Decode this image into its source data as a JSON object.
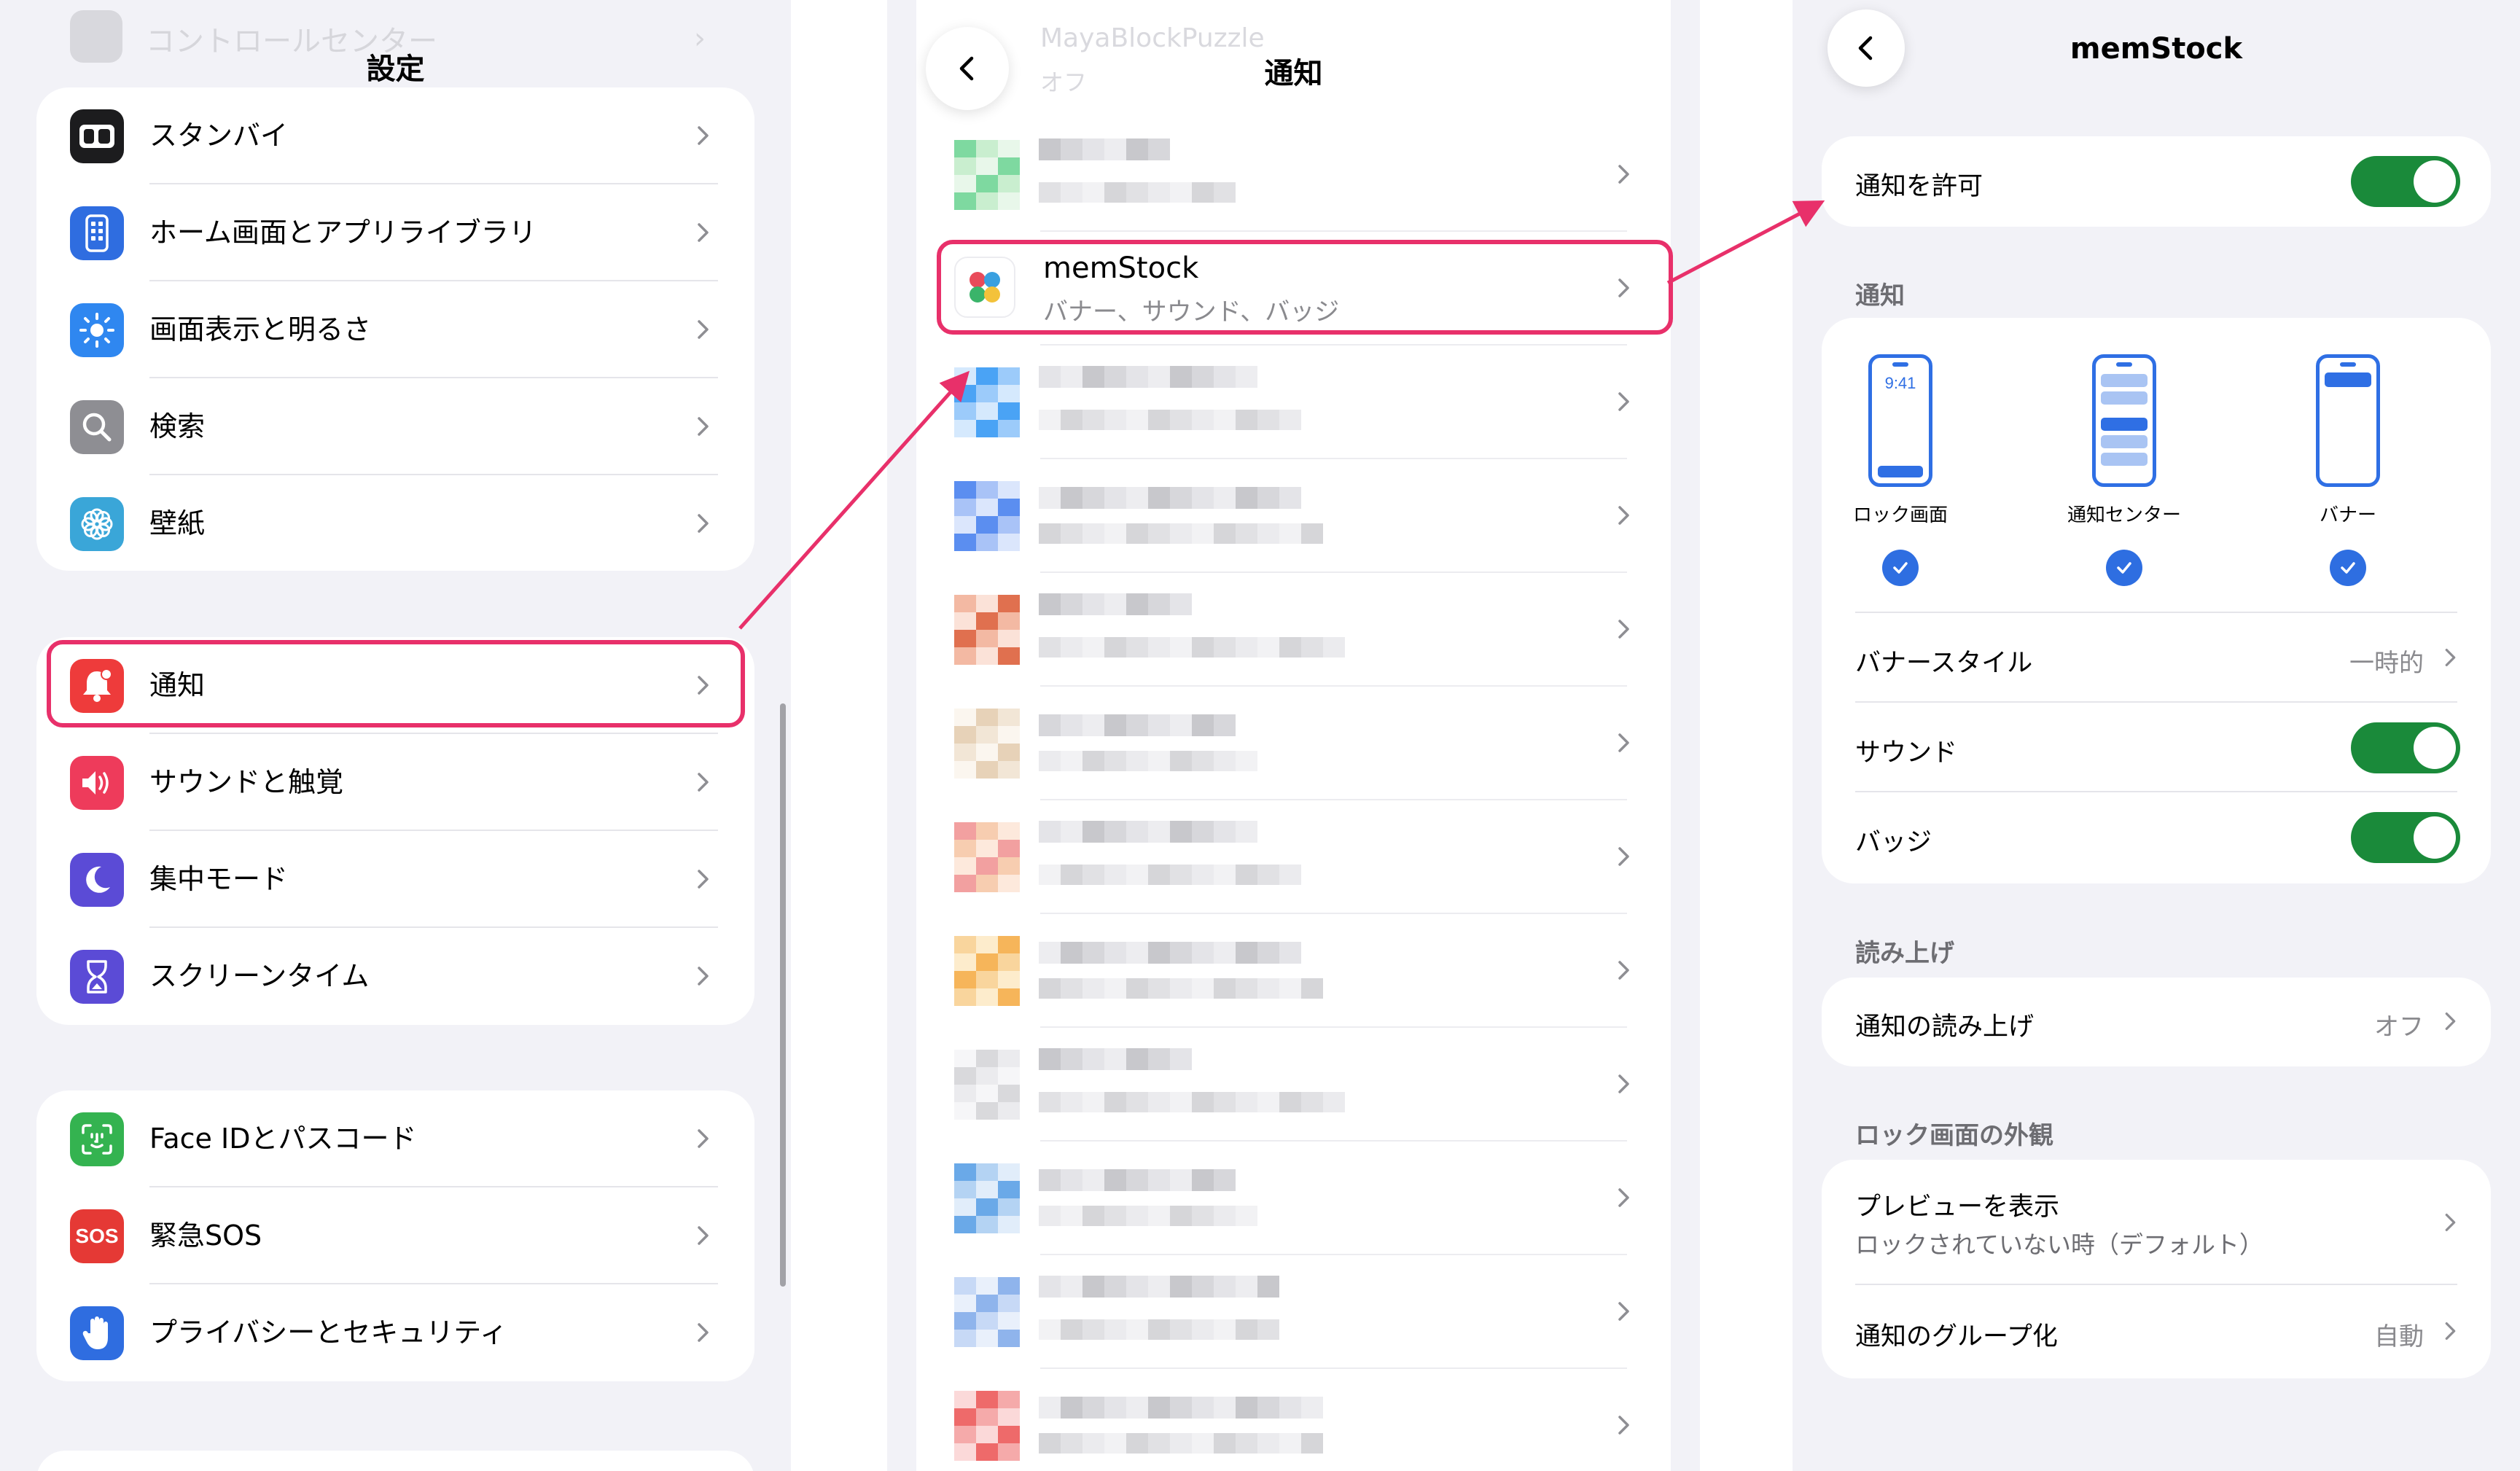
{
  "settings": {
    "ghost_item": "コントロールセンター",
    "title": "設定",
    "group1": [
      {
        "label": "スタンバイ",
        "icon": "standby-icon",
        "color": "#1c1c1e"
      },
      {
        "label": "ホーム画面とアプリライブラリ",
        "icon": "home-screen-icon",
        "color": "#2f6de0"
      },
      {
        "label": "画面表示と明るさ",
        "icon": "brightness-icon",
        "color": "#2f87f0"
      },
      {
        "label": "検索",
        "icon": "search-icon",
        "color": "#8e8e93"
      },
      {
        "label": "壁紙",
        "icon": "wallpaper-icon",
        "color": "#3aa6d8"
      }
    ],
    "group2": [
      {
        "label": "通知",
        "icon": "notification-bell-icon",
        "color": "#ee3b3b"
      },
      {
        "label": "サウンドと触覚",
        "icon": "speaker-icon",
        "color": "#ee3b5b"
      },
      {
        "label": "集中モード",
        "icon": "moon-icon",
        "color": "#5b4bd6"
      },
      {
        "label": "スクリーンタイム",
        "icon": "hourglass-icon",
        "color": "#5b4bd6"
      }
    ],
    "group3": [
      {
        "label": "Face IDとパスコード",
        "icon": "face-id-icon",
        "color": "#34b350"
      },
      {
        "label": "緊急SOS",
        "icon": "sos-icon",
        "color": "#e53935",
        "badge": "SOS"
      },
      {
        "label": "プライバシーとセキュリティ",
        "icon": "hand-icon",
        "color": "#2f6de0"
      }
    ]
  },
  "notifications": {
    "title": "通知",
    "ghost_app": "MayaBlockPuzzle",
    "ghost_sub": "オフ",
    "highlighted_app": {
      "name": "memStock",
      "summary": "バナー、サウンド、バッジ"
    }
  },
  "app_settings": {
    "title": "memStock",
    "allow_label": "通知を許可",
    "section_alerts": "通知",
    "styles": [
      "ロック画面",
      "通知センター",
      "バナー"
    ],
    "lock_time": "9:41",
    "banner_style_label": "バナースタイル",
    "banner_style_value": "一時的",
    "sound_label": "サウンド",
    "badge_label": "バッジ",
    "section_announce": "読み上げ",
    "announce_label": "通知の読み上げ",
    "announce_value": "オフ",
    "section_lock": "ロック画面の外観",
    "preview_label": "プレビューを表示",
    "preview_value": "ロックされていない時（デフォルト）",
    "grouping_label": "通知のグループ化",
    "grouping_value": "自動"
  },
  "colors": {
    "highlight": "#e8306a",
    "toggle_on": "#1a8a3a",
    "accent_blue": "#2f6fe4"
  }
}
